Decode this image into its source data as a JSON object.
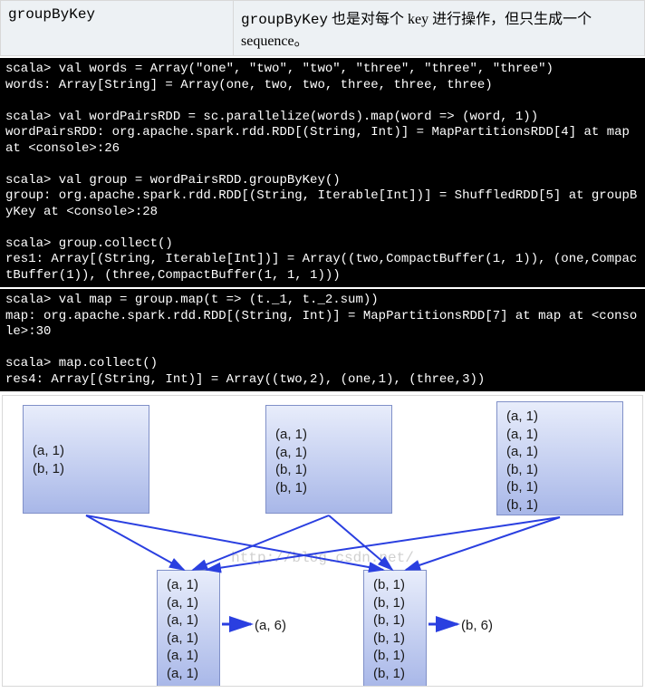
{
  "header": {
    "left": "groupByKey",
    "right_pre": "groupByKey",
    "right_post": " 也是对每个 key 进行操作，但只生成一个 sequence。"
  },
  "terminal1": "scala> val words = Array(\"one\", \"two\", \"two\", \"three\", \"three\", \"three\")\nwords: Array[String] = Array(one, two, two, three, three, three)\n\nscala> val wordPairsRDD = sc.parallelize(words).map(word => (word, 1))\nwordPairsRDD: org.apache.spark.rdd.RDD[(String, Int)] = MapPartitionsRDD[4] at map at <console>:26\n\nscala> val group = wordPairsRDD.groupByKey()\ngroup: org.apache.spark.rdd.RDD[(String, Iterable[Int])] = ShuffledRDD[5] at groupByKey at <console>:28\n\nscala> group.collect()\nres1: Array[(String, Iterable[Int])] = Array((two,CompactBuffer(1, 1)), (one,CompactBuffer(1)), (three,CompactBuffer(1, 1, 1)))",
  "terminal2": "scala> val map = group.map(t => (t._1, t._2.sum))\nmap: org.apache.spark.rdd.RDD[(String, Int)] = MapPartitionsRDD[7] at map at <console>:30\n\nscala> map.collect()\nres4: Array[(String, Int)] = Array((two,2), (one,1), (three,3))",
  "diagram": {
    "watermark": "http://blog.csdn.net/",
    "top": {
      "p1": [
        "(a, 1)",
        "(b, 1)"
      ],
      "p2": [
        "(a, 1)",
        "(a, 1)",
        "(b, 1)",
        "(b, 1)"
      ],
      "p3": [
        "(a, 1)",
        "(a, 1)",
        "(a, 1)",
        "(b, 1)",
        "(b, 1)",
        "(b, 1)"
      ]
    },
    "bottom": {
      "a": [
        "(a, 1)",
        "(a, 1)",
        "(a, 1)",
        "(a, 1)",
        "(a, 1)",
        "(a, 1)"
      ],
      "b": [
        "(b, 1)",
        "(b, 1)",
        "(b, 1)",
        "(b, 1)",
        "(b, 1)",
        "(b, 1)"
      ]
    },
    "results": {
      "a": "(a, 6)",
      "b": "(b, 6)"
    }
  }
}
